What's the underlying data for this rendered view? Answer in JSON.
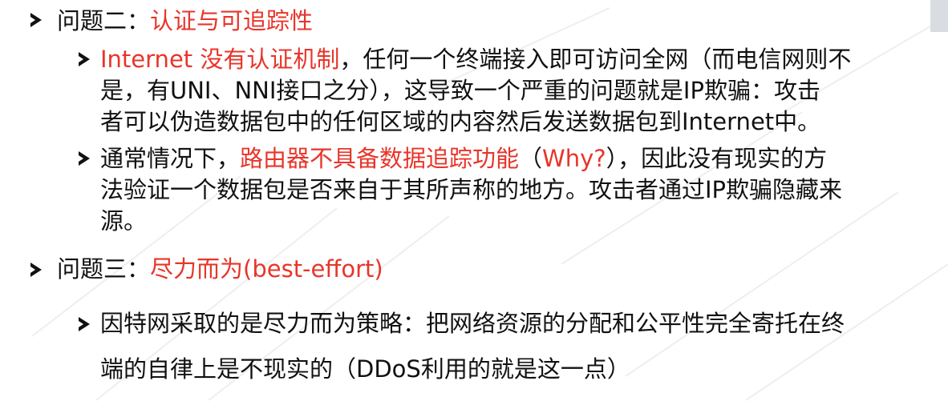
{
  "item1": {
    "label": "问题二：",
    "highlight": "认证与可追踪性"
  },
  "item1_sub1": {
    "line1_red": "Internet 没有认证机制",
    "line1_rest": "，任何一个终端接入即可访问全网（而电信网则不",
    "line2": "是，有UNI、NNI接口之分），这导致一个严重的问题就是IP欺骗：攻击",
    "line3": "者可以伪造数据包中的任何区域的内容然后发送数据包到Internet中。"
  },
  "item1_sub2": {
    "line1_pre": "通常情况下，",
    "line1_red": "路由器不具备数据追踪功能",
    "line1_paren_open": "（",
    "line1_why": "Why?",
    "line1_rest": "），因此没有现实的方",
    "line2": "法验证一个数据包是否来自于其所声称的地方。攻击者通过IP欺骗隐藏来",
    "line3": "源。"
  },
  "item2": {
    "label": "问题三：",
    "highlight": "尽力而为(best-effort)"
  },
  "item2_sub1": {
    "line1": "因特网采取的是尽力而为策略：把网络资源的分配和公平性完全寄托在终",
    "line2": "端的自律上是不现实的（DDoS利用的就是这一点）"
  },
  "colors": {
    "accent": "#e8352a",
    "text": "#111111"
  },
  "icons": [
    "arrow-bullet-icon"
  ]
}
